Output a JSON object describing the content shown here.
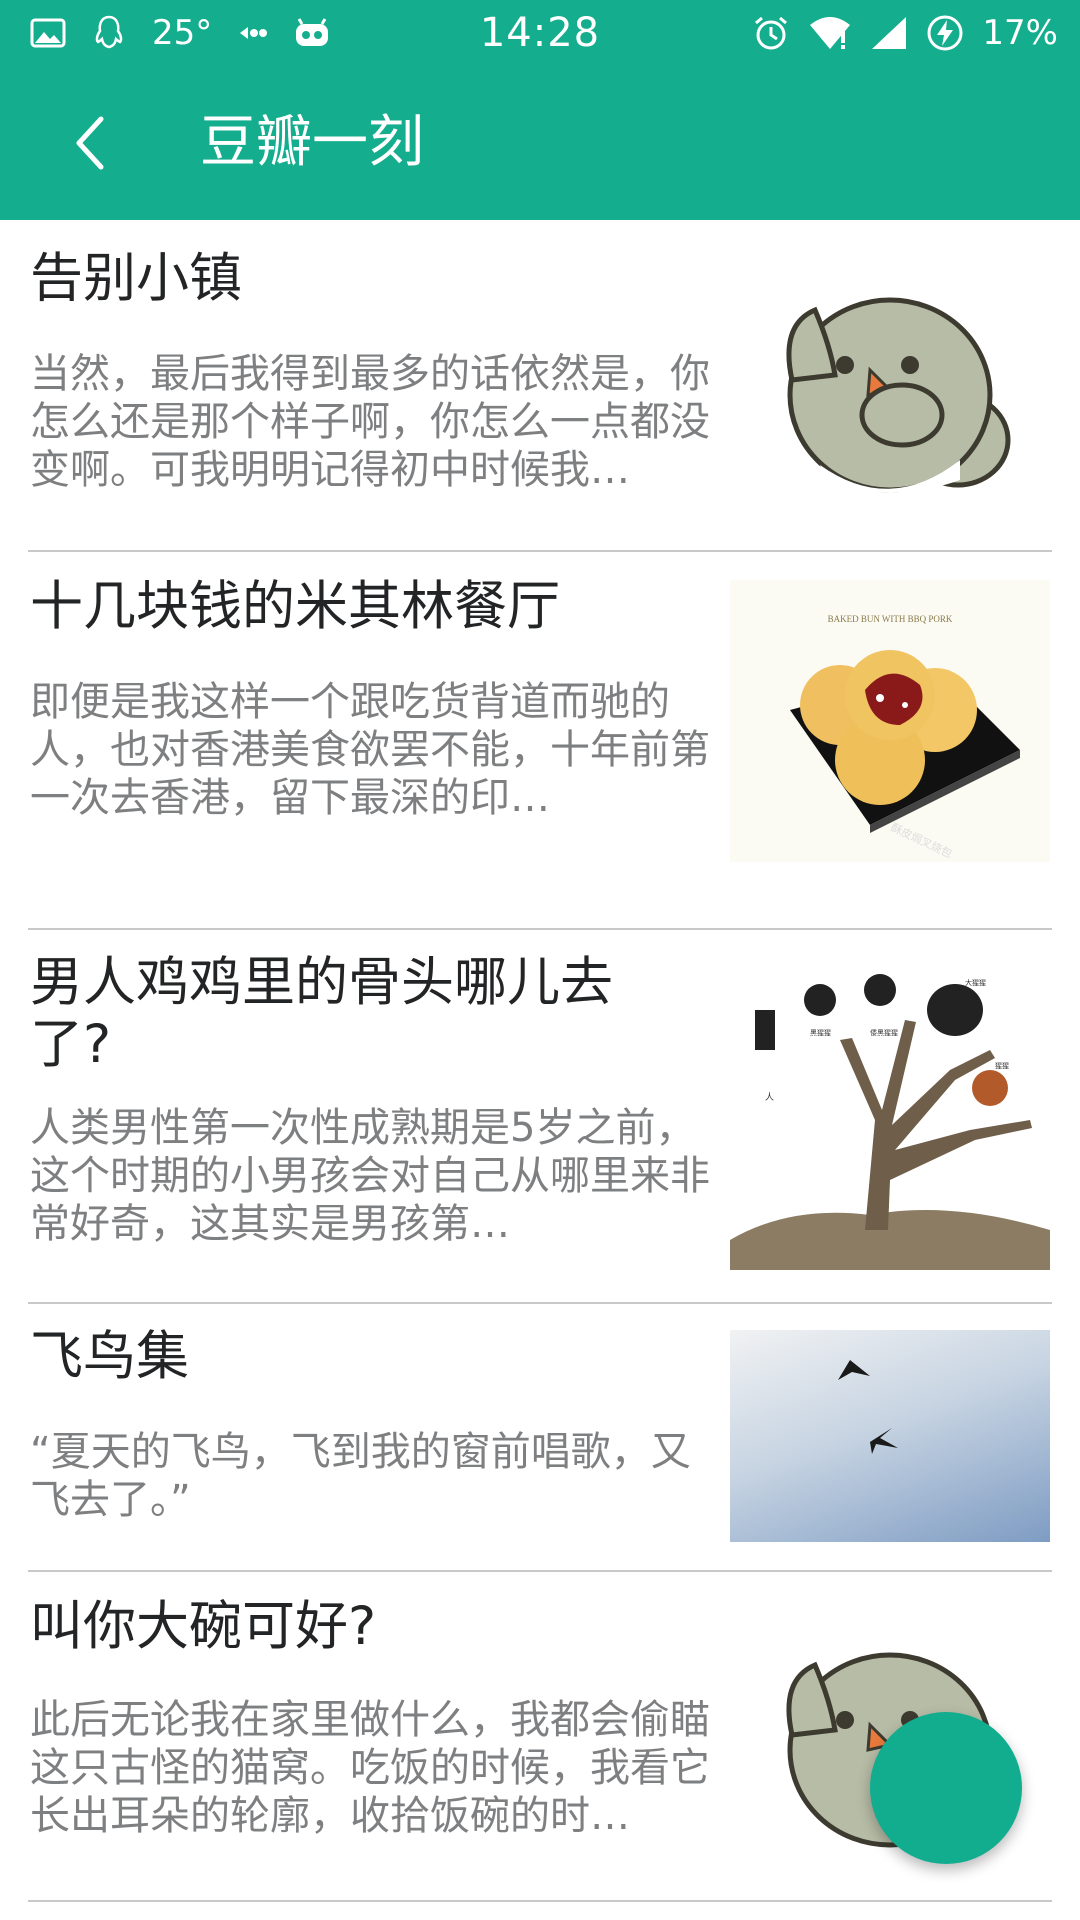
{
  "status_bar": {
    "temperature": "25°",
    "time": "14:28",
    "battery": "17%",
    "icons_left": [
      "image-icon",
      "qq-icon",
      "temperature-text",
      "transfer-icon",
      "android-icon"
    ],
    "icons_right": [
      "alarm-icon",
      "wifi-icon",
      "signal-icon",
      "charging-icon"
    ]
  },
  "app_bar": {
    "title": "豆瓣一刻",
    "back_icon": "chevron-left-icon",
    "background": "#14ad8d"
  },
  "articles": [
    {
      "title": "告别小镇",
      "desc": "当然，最后我得到最多的话依然是，你怎么还是那个样子啊，你怎么一点都没变啊。可我明明记得初中时候我…",
      "thumb": "bird-sticker"
    },
    {
      "title": "十几块钱的米其林餐厅",
      "desc": "即便是我这样一个跟吃货背道而驰的人，也对香港美食欲罢不能，十年前第一次去香港，留下最深的印…",
      "thumb": "bbq-pork-bun",
      "thumb_caption": "BAKED BUN WITH BBQ PORK",
      "thumb_label": "酥皮焗叉烧包"
    },
    {
      "title": "男人鸡鸡里的骨头哪儿去了?",
      "desc": "人类男性第一次性成熟期是5岁之前，这个时期的小男孩会对自己从哪里来非常好奇，这其实是男孩第…",
      "thumb": "primate-tree",
      "thumb_labels": [
        "人",
        "黑猩猩",
        "倭黑猩猩",
        "大猩猩",
        "猩猩"
      ]
    },
    {
      "title": "飞鸟集",
      "desc": "“夏天的飞鸟，飞到我的窗前唱歌，又飞去了。”",
      "thumb": "sky-birds"
    },
    {
      "title": "叫你大碗可好?",
      "desc": " 此后无论我在家里做什么，我都会偷瞄这只古怪的猫窝。吃饭的时候，我看它长出耳朵的轮廓，收拾饭碗的时…",
      "thumb": "bird-sticker"
    }
  ],
  "fab": {
    "color": "#12ac8e"
  }
}
